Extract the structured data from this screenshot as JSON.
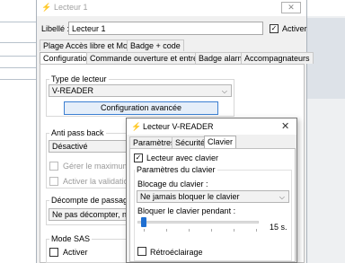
{
  "main_window": {
    "title": "Lecteur 1",
    "libelle_label": "Libellé :",
    "libelle_value": "Lecteur 1",
    "activer_label": "Activer",
    "activer_checked": true,
    "tabs_row1": [
      "Plage Accès libre et Mode",
      "Badge + code"
    ],
    "tabs_row2": [
      "Configuration",
      "Commande ouverture et entrées",
      "Badge alarme",
      "Accompagnateurs"
    ],
    "active_tab": "Configuration"
  },
  "type_lecteur": {
    "title": "Type de lecteur",
    "value": "V-READER",
    "button_label": "Configuration avancée"
  },
  "anti_pass_back": {
    "title": "Anti pass back",
    "value": "Désactivé",
    "gerer_label": "Gérer le maximum pa",
    "activer_validation_label": "Activer la validation c"
  },
  "decompte": {
    "title": "Décompte de passages",
    "value": "Ne pas décompter, ne p"
  },
  "mode_sas": {
    "title": "Mode SAS",
    "activer_label": "Activer"
  },
  "popup": {
    "title": "Lecteur V-READER",
    "close_glyph": "✕",
    "tabs": [
      "Paramètres",
      "Sécurité",
      "Clavier"
    ],
    "active_tab": "Clavier",
    "lecteur_avec_clavier_label": "Lecteur avec clavier",
    "lecteur_avec_clavier_checked": true,
    "params_group_title": "Paramètres du clavier",
    "blocage_label": "Blocage du clavier :",
    "blocage_value": "Ne jamais bloquer le clavier",
    "bloquer_pendant_label": "Bloquer le clavier pendant :",
    "slider_value_text": "15 s.",
    "retroeclairage_label": "Rétroéclairage",
    "retroeclairage_checked": false
  },
  "icons": {
    "app_icon": "lecteur-app-icon",
    "close": "close-icon",
    "chevron": "chevron-down-icon",
    "check": "check-icon"
  },
  "colors": {
    "accent": "#1f6fd1",
    "window_bg": "#f0f0f0",
    "app_icon": "#d04040"
  }
}
